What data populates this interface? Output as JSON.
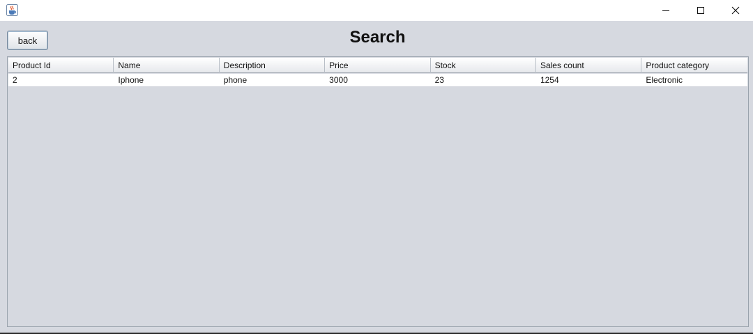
{
  "page": {
    "title": "Search",
    "back_label": "back"
  },
  "table": {
    "columns": [
      "Product Id",
      "Name",
      "Description",
      "Price",
      "Stock",
      "Sales count",
      "Product category"
    ],
    "rows": [
      [
        "2",
        "Iphone",
        "phone",
        "3000",
        "23",
        "1254",
        "Electronic"
      ]
    ]
  },
  "icons": {
    "app": "java-cup-icon",
    "minimize": "minimize-icon",
    "maximize": "maximize-icon",
    "close": "close-icon"
  }
}
